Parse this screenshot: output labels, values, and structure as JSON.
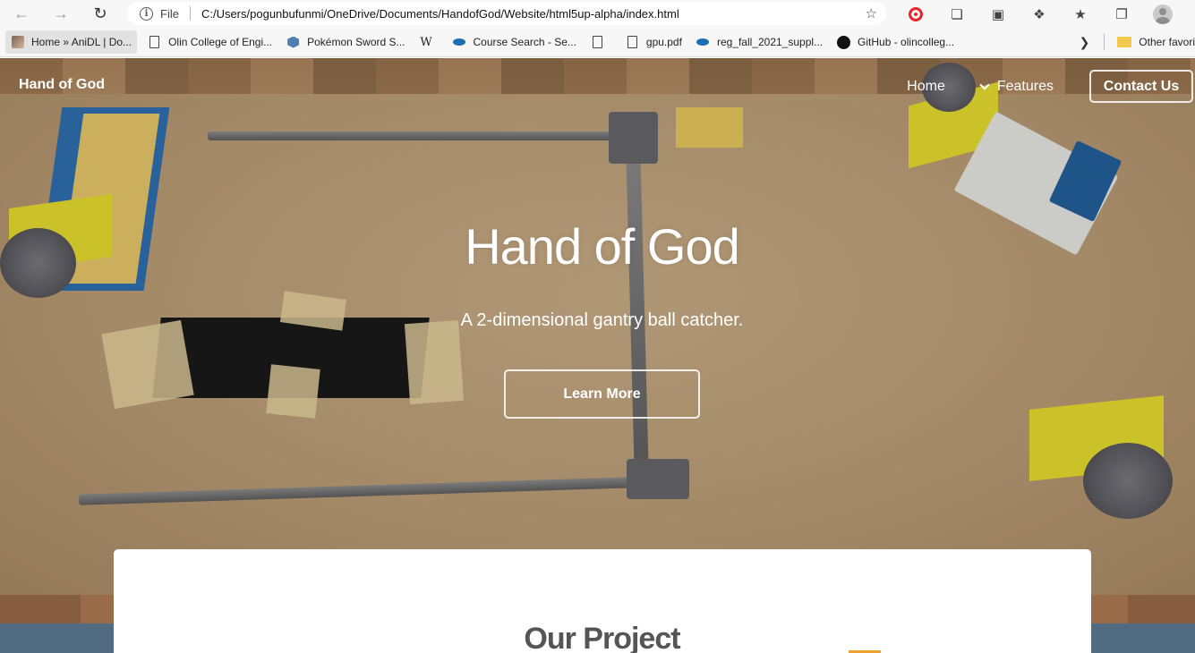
{
  "browser": {
    "address": {
      "scheme_label": "File",
      "url": "C:/Users/pogunbufunmi/OneDrive/Documents/HandofGod/Website/html5up-alpha/index.html"
    },
    "bookmarks": [
      {
        "label": "Home » AniDL | Do...",
        "icon": "anime-icon"
      },
      {
        "label": "Olin College of Engi...",
        "icon": "page-icon"
      },
      {
        "label": "Pokémon Sword S...",
        "icon": "hex-icon"
      },
      {
        "label": "",
        "icon": "wikipedia-icon"
      },
      {
        "label": "Course Search - Se...",
        "icon": "eye-icon"
      },
      {
        "label": "",
        "icon": "page-icon"
      },
      {
        "label": "gpu.pdf",
        "icon": "page-icon"
      },
      {
        "label": "reg_fall_2021_suppl...",
        "icon": "eye-icon"
      },
      {
        "label": "GitHub - olincolleg...",
        "icon": "github-icon"
      }
    ],
    "other_favorites": "Other favori"
  },
  "site": {
    "logo": "Hand of God",
    "nav": {
      "home": "Home",
      "features": "Features",
      "contact": "Contact Us"
    },
    "hero": {
      "title": "Hand of God",
      "subtitle": "A 2-dimensional gantry ball catcher.",
      "cta": "Learn More"
    },
    "section": {
      "title": "Our Project"
    }
  }
}
